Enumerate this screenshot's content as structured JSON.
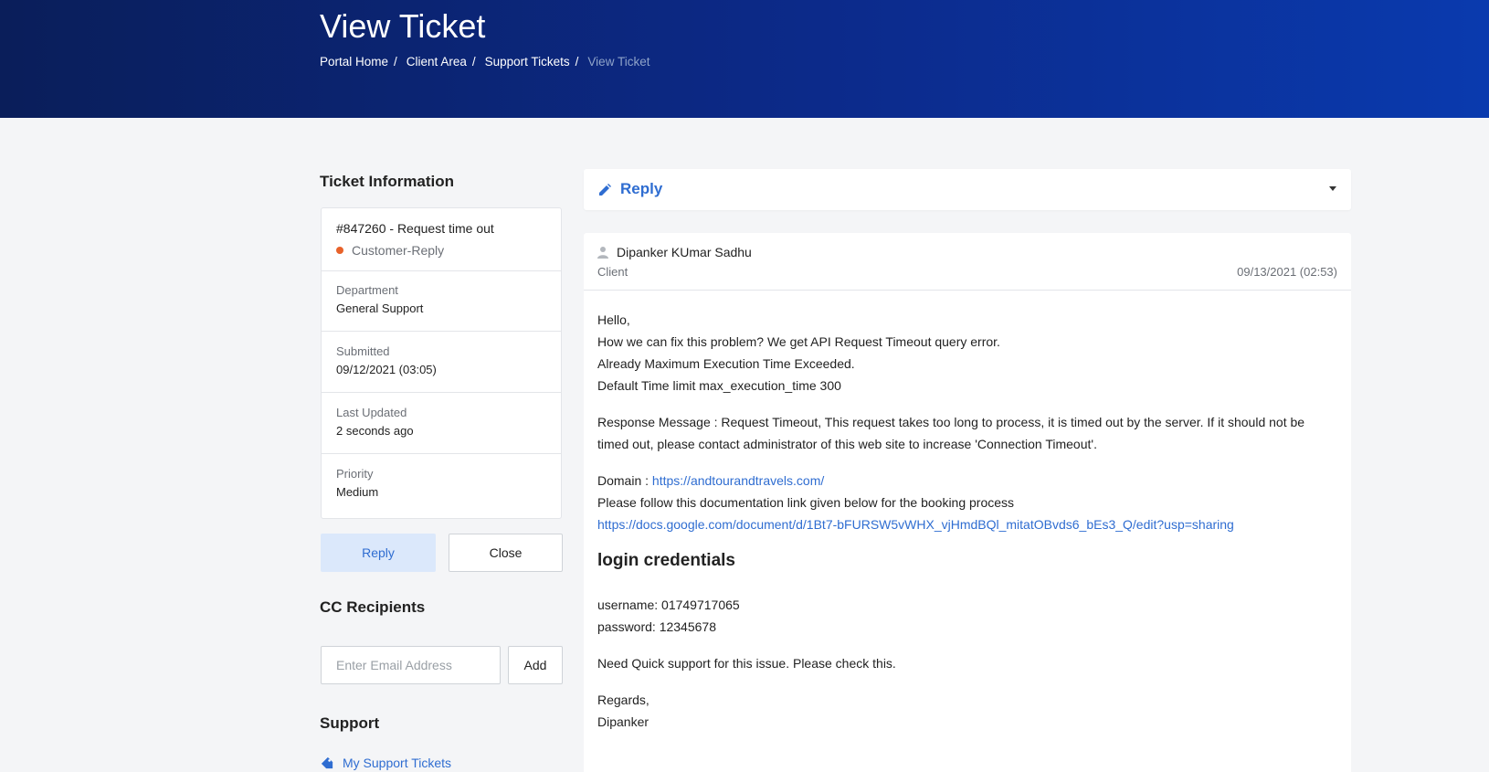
{
  "header": {
    "title": "View Ticket",
    "breadcrumb": [
      "Portal Home",
      "Client Area",
      "Support Tickets"
    ],
    "breadcrumb_current": "View Ticket"
  },
  "sidebar": {
    "ticket_info_heading": "Ticket Information",
    "ticket_title": "#847260 - Request time out",
    "status": "Customer-Reply",
    "department_label": "Department",
    "department_value": "General Support",
    "submitted_label": "Submitted",
    "submitted_value": "09/12/2021 (03:05)",
    "updated_label": "Last Updated",
    "updated_value": "2 seconds ago",
    "priority_label": "Priority",
    "priority_value": "Medium",
    "reply_button": "Reply",
    "close_button": "Close",
    "cc_heading": "CC Recipients",
    "email_placeholder": "Enter Email Address",
    "add_button": "Add",
    "support_heading": "Support",
    "support_link": "My Support Tickets"
  },
  "reply_bar": {
    "label": "Reply"
  },
  "message": {
    "author": "Dipanker KUmar Sadhu",
    "role": "Client",
    "date": "09/13/2021 (02:53)",
    "line1": "Hello,",
    "line2": "How we can fix this problem? We get API Request Timeout query error.",
    "line3": "Already Maximum Execution Time Exceeded.",
    "line4": "Default Time limit max_execution_time 300",
    "response": "Response Message : Request Timeout, This request takes too long to process, it is timed out by the server. If it should not be timed out, please contact administrator of this web site to increase 'Connection Timeout'.",
    "domain_label": "Domain : ",
    "domain_link": "https://andtourandtravels.com/",
    "doc_text": "Please follow this documentation link given below for the booking process",
    "doc_link": "https://docs.google.com/document/d/1Bt7-bFURSW5vWHX_vjHmdBQl_mitatOBvds6_bEs3_Q/edit?usp=sharing",
    "cred_heading": "login credentials",
    "username": "username: 01749717065",
    "password": "password: 12345678",
    "need": "Need Quick support for this issue. Please check this.",
    "regards": "Regards,",
    "signature": "Dipanker"
  },
  "colors": {
    "accent": "#2f6dd1",
    "status_dot": "#e8622a",
    "header_bg": "#0c2a8a"
  }
}
